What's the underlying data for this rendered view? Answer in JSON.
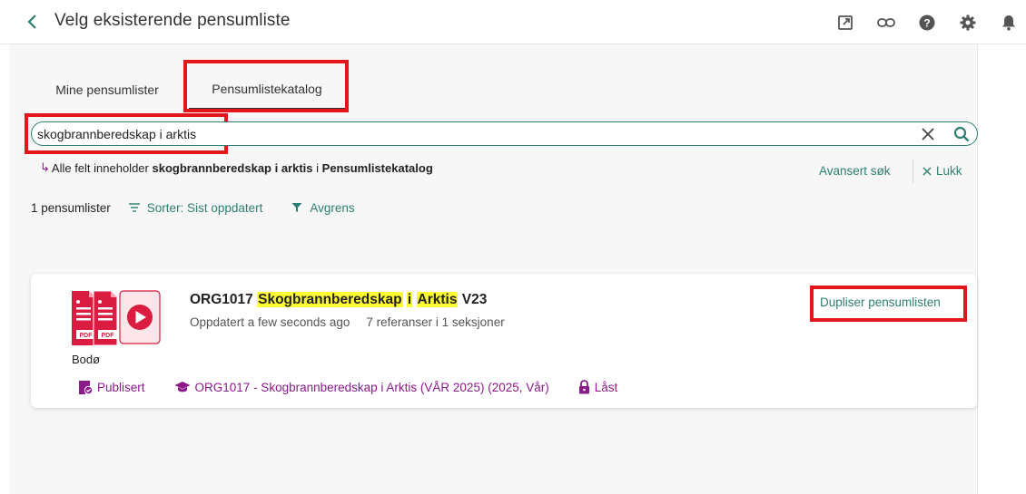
{
  "header": {
    "title": "Velg eksisterende pensumliste",
    "icons": [
      "back-chevron-icon",
      "open-external-icon",
      "link-icon",
      "help-icon",
      "gear-icon",
      "bell-icon"
    ]
  },
  "tabs": [
    {
      "label": "Mine pensumlister",
      "active": false
    },
    {
      "label": "Pensumlistekatalog",
      "active": true
    }
  ],
  "search": {
    "value": "skogbrannberedskap i arktis",
    "placeholder": ""
  },
  "search_summary": {
    "prefix": "Alle felt inneholder",
    "term": "skogbrannberedskap i arktis",
    "in_word": "i",
    "scope": "Pensumlistekatalog"
  },
  "advanced_search": "Avansert søk",
  "close_label": "Lukk",
  "results": {
    "count": "1 pensumlister",
    "sort": "Sorter: Sist oppdatert",
    "filter": "Avgrens"
  },
  "card": {
    "code": "ORG1017",
    "title_part1": "Skogbrannberedskap",
    "title_mid": "i",
    "title_part2": "Arktis",
    "title_suffix": "V23",
    "updated": "Oppdatert a few seconds ago",
    "references": "7 referanser i 1 seksjoner",
    "campus": "Bodø",
    "duplicate": "Dupliser pensumlisten",
    "status": "Publisert",
    "course": "ORG1017 - Skogbrannberedskap i Arktis (VÅR 2025) (2025, Vår)",
    "lock": "Låst",
    "thumb_label": "PDF"
  },
  "colors": {
    "accent": "#2d7f72",
    "tag": "#8b1a8b",
    "highlight": "#ffff33",
    "annotation": "#e3161b",
    "pdf_red": "#d91c3f"
  }
}
